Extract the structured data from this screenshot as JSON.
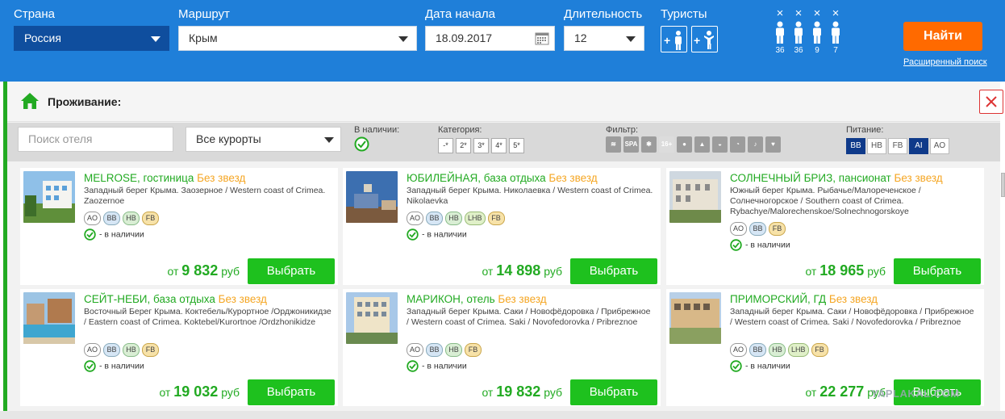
{
  "search": {
    "country_label": "Страна",
    "country_value": "Россия",
    "route_label": "Маршрут",
    "route_value": "Крым",
    "date_label": "Дата начала",
    "date_value": "18.09.2017",
    "duration_label": "Длительность",
    "duration_value": "12",
    "tourists_label": "Туристы",
    "add_adult": "+",
    "add_child": "+",
    "tourists": [
      {
        "remove": "×",
        "age": "36"
      },
      {
        "remove": "×",
        "age": "36"
      },
      {
        "remove": "×",
        "age": "9"
      },
      {
        "remove": "×",
        "age": "7"
      }
    ],
    "find_button": "Найти",
    "advanced_link": "Расширенный поиск",
    "colors": {
      "bar": "#1f7fd9",
      "find": "#ff6a00"
    }
  },
  "panel": {
    "title": "Проживание:",
    "filters": {
      "hotel_search_placeholder": "Поиск отеля",
      "resorts_value": "Все курорты",
      "availability_label": "В наличии:",
      "category_label": "Категория:",
      "categories": [
        "-*",
        "2*",
        "3*",
        "4*",
        "5*"
      ],
      "filter_label": "Фильтр:",
      "filter_icons": [
        "beach-icon",
        "spa-icon",
        "medical-icon",
        "age-16-icon",
        "pet-icon",
        "like-icon",
        "pool-icon",
        "sport-icon",
        "animation-icon",
        "romance-icon"
      ],
      "filter_age_text": "16+",
      "filter_spa_text": "SPA",
      "meals_label": "Питание:",
      "meals": [
        {
          "code": "BB",
          "selected": true
        },
        {
          "code": "HB",
          "selected": false
        },
        {
          "code": "FB",
          "selected": false
        },
        {
          "code": "AI",
          "selected": true
        },
        {
          "code": "AO",
          "selected": false
        }
      ]
    }
  },
  "hotels": [
    {
      "name": "MELROSE, гостиница",
      "stars": "Без звезд",
      "address": "Западный берег Крыма. Заозерное / Western coast of Crimea. Zaozernoe",
      "meals": [
        "AO",
        "BB",
        "HB",
        "FB"
      ],
      "availability": "- в наличии",
      "price_prefix": "от",
      "price": "9 832",
      "currency": "руб",
      "button": "Выбрать"
    },
    {
      "name": "ЮБИЛЕЙНАЯ, база отдыха",
      "stars": "Без звезд",
      "address": "Западный берег Крыма. Николаевка / Western coast of Crimea. Nikolaevka",
      "meals": [
        "AO",
        "BB",
        "HB",
        "LHB",
        "FB"
      ],
      "availability": "- в наличии",
      "price_prefix": "от",
      "price": "14 898",
      "currency": "руб",
      "button": "Выбрать"
    },
    {
      "name": "СОЛНЕЧНЫЙ БРИЗ, пансионат",
      "stars": "Без звезд",
      "address": "Южный берег Крыма. Рыбачье/Малореченское /Солнечногорское / Southern coast of Crimea. Rybachye/Malorechenskoe/Solnechnogorskoye",
      "meals": [
        "AO",
        "BB",
        "FB"
      ],
      "availability": "- в наличии",
      "price_prefix": "от",
      "price": "18 965",
      "currency": "руб",
      "button": "Выбрать"
    },
    {
      "name": "СЕЙТ-НЕБИ, база отдыха",
      "stars": "Без звезд",
      "address": "Восточный Берег Крыма. Коктебель/Курортное /Орджоникидзе / Eastern coast of Crimea. Koktebel/Kurortnoe /Ordzhonikidze",
      "meals": [
        "AO",
        "BB",
        "HB",
        "FB"
      ],
      "availability": "- в наличии",
      "price_prefix": "от",
      "price": "19 032",
      "currency": "руб",
      "button": "Выбрать"
    },
    {
      "name": "МАРИКОН, отель",
      "stars": "Без звезд",
      "address": "Западный берег Крыма. Саки / Новофёдоровка / Прибрежное / Western coast of Crimea. Saki / Novofedorovka / Pribreznoe",
      "meals": [
        "AO",
        "BB",
        "HB",
        "FB"
      ],
      "availability": "- в наличии",
      "price_prefix": "от",
      "price": "19 832",
      "currency": "руб",
      "button": "Выбрать"
    },
    {
      "name": "ПРИМОРСКИЙ, ГД",
      "stars": "Без звезд",
      "address": "Западный берег Крыма. Саки / Новофёдоровка / Прибрежное / Western coast of Crimea. Saki / Novofedorovka / Pribreznoe",
      "meals": [
        "AO",
        "BB",
        "HB",
        "LHB",
        "FB"
      ],
      "availability": "- в наличии",
      "price_prefix": "от",
      "price": "22 277",
      "currency": "руб",
      "button": "Выбрать"
    }
  ],
  "watermark": "YAPLAKAL.COM"
}
